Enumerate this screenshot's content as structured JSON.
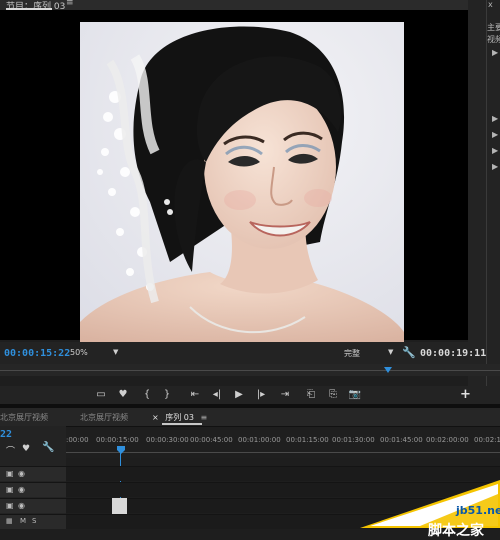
{
  "program_monitor": {
    "title": "节目：序列 03",
    "menu_glyph": "≡",
    "viewer": {
      "image_alt": "Portrait of a smiling woman with black hair and white flowers in her hair against a white background"
    },
    "current_timecode": "00:00:15:22",
    "zoom_level": "50%",
    "playback_quality": "完整",
    "duration": "00:00:19:11",
    "scrub_position_fraction": 0.78,
    "transport_icons": [
      "marker-icon",
      "mark-in-icon",
      "mark-out-icon",
      "go-to-in-icon",
      "step-back-icon",
      "play-icon",
      "step-forward-icon",
      "go-to-out-icon",
      "insert-icon",
      "overwrite-icon",
      "export-frame-icon"
    ],
    "add_button": "+"
  },
  "right_panel": {
    "items": [
      "主要",
      "视频",
      "▶",
      "▶",
      "▶",
      "▶",
      "▶"
    ],
    "title_text_top": "x"
  },
  "timeline": {
    "tabs": [
      {
        "label": "北京展厅视频"
      },
      {
        "label": "北京展厅视频"
      },
      {
        "label": "序列 03",
        "close": "×",
        "menu": "≡",
        "active": true
      }
    ],
    "timecode": "22",
    "ruler_labels": [
      ":00:00",
      "00:00:15:00",
      "00:00:30:00",
      "00:00:45:00",
      "00:01:00:00",
      "00:01:15:00",
      "00:01:30:00",
      "00:01:45:00",
      "00:02:00:00",
      "00:02:1"
    ],
    "tracks": [
      {
        "type": "video",
        "name": "V3",
        "toggle": "◉"
      },
      {
        "type": "video",
        "name": "V2",
        "toggle": "◉"
      },
      {
        "type": "video",
        "name": "V1",
        "toggle": "◉"
      },
      {
        "type": "audio",
        "name": "A1",
        "mute": "M",
        "solo": "S"
      }
    ]
  },
  "watermark": {
    "url": "jb51.net",
    "brand": "脚本之家"
  },
  "colors": {
    "accent": "#2f8fdc",
    "panel": "#232323",
    "watermark_blue": "#0a58a8"
  }
}
